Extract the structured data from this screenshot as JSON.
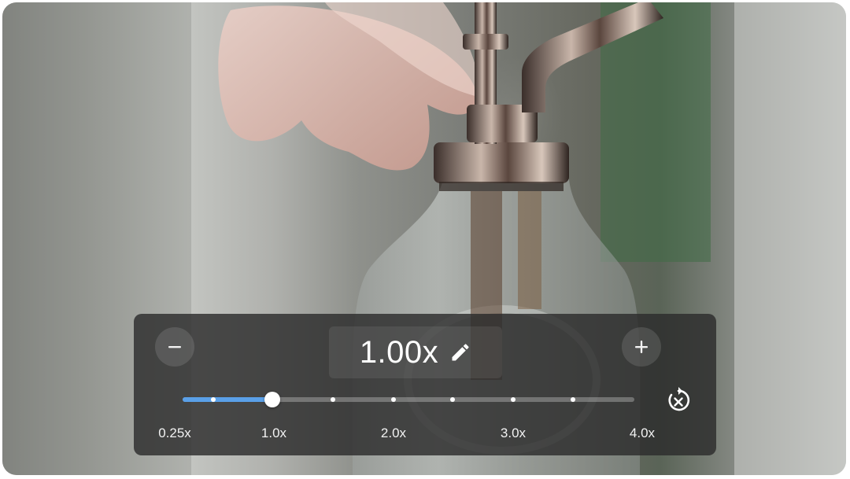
{
  "player": {
    "speed_display": "1.00x",
    "speed_value": 1.0,
    "slider_min": 0.25,
    "slider_max": 4.0,
    "scale_labels": [
      "0.25x",
      "1.0x",
      "2.0x",
      "3.0x",
      "4.0x"
    ],
    "accent_color": "#5aa0e8",
    "icons": {
      "decrease": "minus-icon",
      "increase": "plus-icon",
      "edit": "pencil-icon",
      "reset": "reset-speed-icon"
    }
  }
}
